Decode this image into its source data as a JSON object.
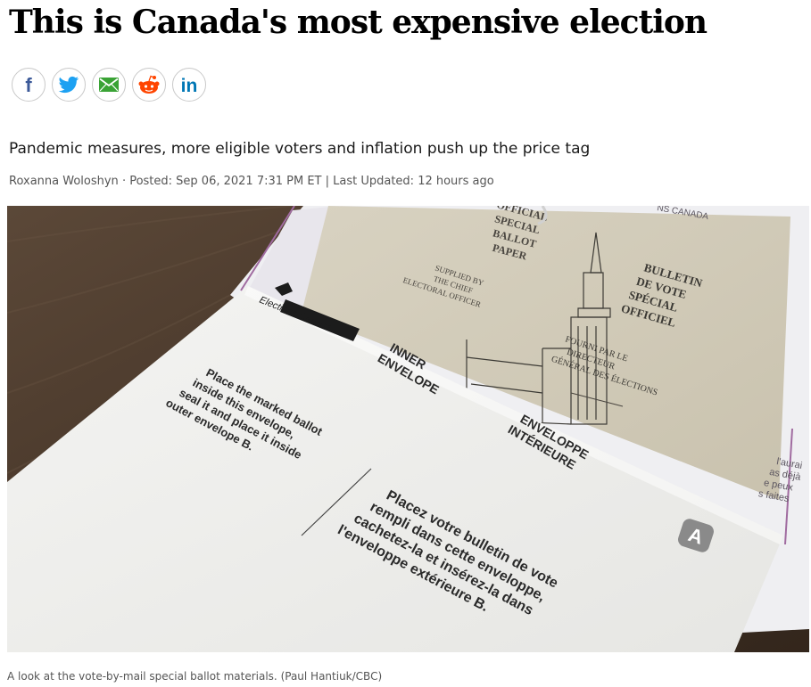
{
  "article": {
    "headline": "This is Canada's most expensive election",
    "subhead": "Pandemic measures, more eligible voters and inflation push up the price tag",
    "byline": {
      "author": "Roxanna Woloshyn",
      "posted": "· Posted: Sep 06, 2021 7:31 PM ET | Last Updated: 12 hours ago"
    },
    "caption": "A look at the vote-by-mail special ballot materials. (Paul Hantiuk/CBC)"
  },
  "share": [
    {
      "name": "facebook-icon",
      "color": "#3b5998"
    },
    {
      "name": "twitter-icon",
      "color": "#1da1f2"
    },
    {
      "name": "email-icon",
      "color": "#3aa335"
    },
    {
      "name": "reddit-icon",
      "color": "#ff4500"
    },
    {
      "name": "linkedin-icon",
      "color": "#0077b5"
    }
  ],
  "photo": {
    "ballot_en": [
      "OFFICIAL",
      "SPECIAL",
      "BALLOT",
      "PAPER"
    ],
    "supplied_en": [
      "SUPPLIED BY",
      "THE CHIEF",
      "ELECTORAL OFFICER"
    ],
    "ballot_fr": [
      "BULLETIN",
      "DE VOTE",
      "SPÉCIAL",
      "OFFICIEL"
    ],
    "supplied_fr": [
      "FOURNI PAR LE",
      "DIRECTEUR",
      "GÉNÉRAL DES ÉLECTIONS"
    ],
    "logo_text": "Elections Canada",
    "inner_en": [
      "INNER",
      "ENVELOPE"
    ],
    "inner_fr": [
      "ENVELOPPE",
      "INTÉRIEURE"
    ],
    "instructions_en": [
      "Place the marked ballot",
      "inside this envelope,",
      "seal it and place it inside",
      "outer envelope B."
    ],
    "instructions_fr": [
      "Placez votre bulletin de vote",
      "rempli dans cette enveloppe,",
      "cachetez-la et insérez-la dans",
      "l'enveloppe extérieure B."
    ],
    "envelope_letter": "A",
    "back_header": "NS CANADA",
    "back_side_fr": [
      "l'aurai",
      "as déjà",
      "e peux",
      "s faites"
    ]
  }
}
